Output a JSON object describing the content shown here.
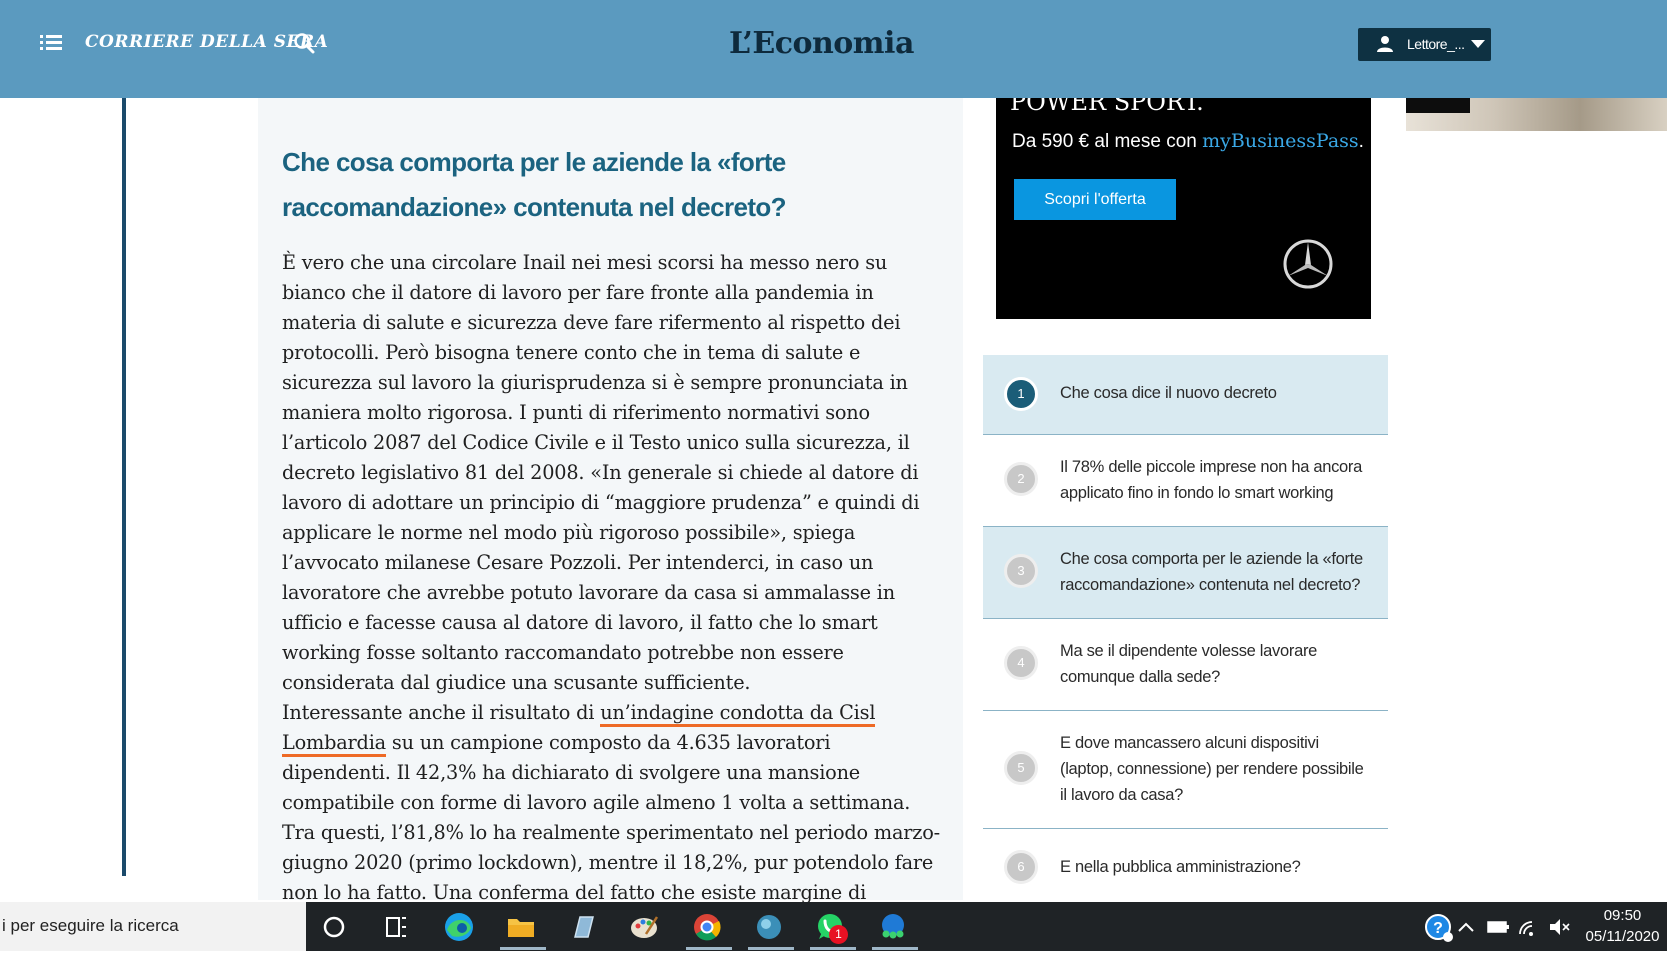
{
  "header": {
    "site_logo": "CORRIERE DELLA SERA",
    "brand": "L’Economia",
    "user_button_label": "Lettore_..."
  },
  "article": {
    "heading": "Che cosa comporta per le aziende la «forte raccomandazione» contenuta nel decreto?",
    "paragraph1": "È vero che una circolare Inail nei mesi scorsi ha messo nero su bianco che il datore di lavoro per fare fronte alla pandemia in materia di salute e sicurezza deve fare rifermento al rispetto dei protocolli. Però bisogna tenere conto che in tema di salute e sicurezza sul lavoro la giurisprudenza si è sempre pronunciata in maniera molto rigorosa. I punti di riferimento normativi sono l’articolo 2087 del Codice Civile e il Testo unico sulla sicurezza, il decreto legislativo 81 del 2008. «In generale si chiede al datore di lavoro di adottare un principio di “maggiore prudenza” e quindi di applicare le norme nel modo più rigoroso possibile», spiega l’avvocato milanese Cesare Pozzoli. Per intenderci, in caso un lavoratore che avrebbe potuto lavorare da casa si ammalasse in ufficio e facesse causa al datore di lavoro, il fatto che lo smart working fosse soltanto raccomandato potrebbe non essere considerata dal giudice una scusante sufficiente.",
    "paragraph2_before": "Interessante anche il risultato di ",
    "paragraph2_link": "un’indagine condotta da Cisl Lombardia",
    "paragraph2_after": " su un campione composto da 4.635 lavoratori dipendenti. Il 42,3% ha dichiarato di svolgere una mansione compatibile con forme di lavoro agile almeno 1 volta a settimana. Tra questi, l’81,8% lo ha realmente sperimentato nel periodo marzo-giugno 2020 (primo lockdown), mentre il 18,2%, pur potendolo fare non lo ha fatto. Una conferma del fatto che esiste margine di allargamento della platea di coloro che lavorano fuori ufficio."
  },
  "ad": {
    "top_text": "POWER SPORT.",
    "price_text": "Da 590 € al mese con ",
    "brand_my": "my",
    "brand_bp": "BusinessPass",
    "brand_end": ".",
    "cta": "Scopri l'offerta"
  },
  "toc": [
    {
      "num": "1",
      "text": "Che cosa dice il nuovo decreto",
      "active": true
    },
    {
      "num": "2",
      "text": "Il 78% delle piccole imprese non ha ancora applicato fino in fondo lo smart working",
      "active": false
    },
    {
      "num": "3",
      "text": "Che cosa comporta per le aziende la «forte raccomandazione» contenuta nel decreto?",
      "active": true
    },
    {
      "num": "4",
      "text": "Ma se il dipendente volesse lavorare comunque dalla sede?",
      "active": false
    },
    {
      "num": "5",
      "text": "E dove mancassero alcuni dispositivi (laptop, connessione) per rendere possibile il lavoro da casa?",
      "active": false
    },
    {
      "num": "6",
      "text": "E nella pubblica amministrazione?",
      "active": false
    }
  ],
  "taskbar": {
    "search_text": "i per eseguire la ricerca",
    "whatsapp_badge": "1",
    "time": "09:50",
    "date": "05/11/2020"
  },
  "colors": {
    "header_bg": "#5b9abf",
    "heading": "#1b6380",
    "link_underline": "#ee6a26",
    "ad_button": "#0a96e0"
  }
}
